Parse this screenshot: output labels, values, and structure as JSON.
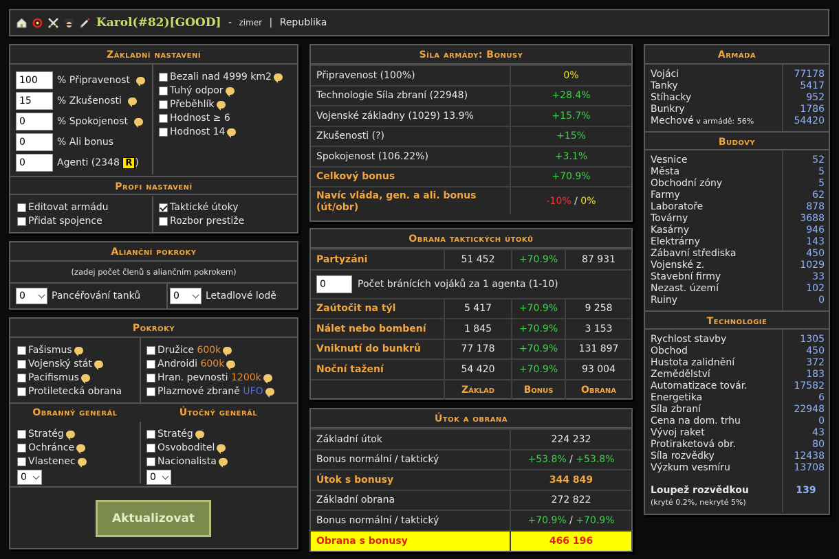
{
  "topbar": {
    "icons": [
      "home-icon",
      "alert-icon",
      "swords-icon",
      "spy-icon",
      "syringe-icon"
    ],
    "username": "Karol(#82)[GOOD]",
    "dash": " - ",
    "tag": "zimer",
    "sep": " | ",
    "government": "Republika"
  },
  "zakladni": {
    "title": "Základní nastavení",
    "fields": [
      {
        "value": "100",
        "label": "% Připravenost"
      },
      {
        "value": "15",
        "label": "% Zkušenosti"
      },
      {
        "value": "0",
        "label": "% Spokojenost"
      },
      {
        "value": "0",
        "label": "% Ali bonus"
      },
      {
        "value": "0",
        "label": "Agenti (2348 ",
        "badge": "R",
        "suffix": ")"
      }
    ],
    "checks": [
      {
        "label": "Bezali nad 4999 km2",
        "checked": false
      },
      {
        "label": "Tuhý odpor",
        "checked": false
      },
      {
        "label": "Přeběhlík",
        "checked": false
      },
      {
        "label": "Hodnost ≥ 6",
        "checked": false
      },
      {
        "label": "Hodnost 14",
        "checked": false
      }
    ]
  },
  "profi": {
    "title": "Profi nastavení",
    "left": [
      {
        "label": "Editovat armádu"
      },
      {
        "label": "Přidat spojence"
      }
    ],
    "right": [
      {
        "label": "Taktické útoky",
        "checked": true
      },
      {
        "label": "Rozbor prestiže",
        "checked": false
      }
    ]
  },
  "alianc": {
    "title": "Alianční pokroky",
    "note": "(zadej počet členů s aliančním pokrokem)",
    "sel1": {
      "value": "0",
      "label": "Pancéřování tanků"
    },
    "sel2": {
      "value": "0",
      "label": "Letadlové lodě"
    }
  },
  "pokroky": {
    "title": "Pokroky",
    "left": [
      "Fašismus",
      "Vojenský stát",
      "Pacifismus",
      "Protiletecká obrana"
    ],
    "right": [
      {
        "label": "Družice",
        "extra": "600k"
      },
      {
        "label": "Androidi",
        "extra": "600k"
      },
      {
        "label": "Hran. pevnosti",
        "extra": "1200k"
      },
      {
        "label": "Plazmové zbraně",
        "extra": "UFO"
      }
    ]
  },
  "general": {
    "obranny_title": "Obranný generál",
    "utocny_title": "Útočný generál",
    "obranny": [
      "Stratég",
      "Ochránce",
      "Vlastenec"
    ],
    "utocny": [
      "Stratég",
      "Osvoboditel",
      "Nacionalista"
    ],
    "sel_obr": "0",
    "sel_uto": "0"
  },
  "button": "Aktualizovat",
  "sila": {
    "title": "Síla armády: Bonusy",
    "rows": [
      {
        "label": "Připravenost (100%)",
        "value": "0%"
      },
      {
        "label": "Technologie Síla zbraní (22948)",
        "value": "+28.4%"
      },
      {
        "label": "Vojenské základny (1029) 13.9%",
        "value": "+15.7%"
      },
      {
        "label": "Zkušenosti (?)",
        "value": "+15%"
      },
      {
        "label": "Spokojenost (106.22%)",
        "value": "+3.1%"
      },
      {
        "label": "Celkový bonus",
        "value": "+70.9%"
      }
    ],
    "extra_label": "Navíc vláda, gen. a ali. bonus (út/obr)",
    "extra_a": "-10%",
    "extra_sep": " / ",
    "extra_b": "0%"
  },
  "obrana": {
    "title": "Obrana taktických útoků",
    "partyzani": {
      "label": "Partyzáni",
      "a": "51 452",
      "b": "+70.9%",
      "c": "87 931"
    },
    "agent_input": "0",
    "agent_label": "Počet bránících vojáků za 1 agenta (1-10)",
    "rows": [
      {
        "label": "Zaútočit na týl",
        "a": "5 417",
        "b": "+70.9%",
        "c": "9 258"
      },
      {
        "label": "Nálet nebo bombení",
        "a": "1 845",
        "b": "+70.9%",
        "c": "3 153"
      },
      {
        "label": "Vniknutí do bunkrů",
        "a": "77 178",
        "b": "+70.9%",
        "c": "131 897"
      },
      {
        "label": "Noční tažení",
        "a": "54 420",
        "b": "+70.9%",
        "c": "93 004"
      }
    ],
    "foot": [
      "Základ",
      "Bonus",
      "Obrana"
    ]
  },
  "utok": {
    "title": "Útok a obrana",
    "zakladni_utok": {
      "label": "Základní útok",
      "value": "224 232"
    },
    "bonus_u": {
      "label": "Bonus normální / taktický",
      "a": "+53.8%",
      "sep": " / ",
      "b": "+53.8%"
    },
    "utok_bonusy": {
      "label": "Útok s bonusy",
      "value": "344 849"
    },
    "zakladni_obrana": {
      "label": "Základní obrana",
      "value": "272 822"
    },
    "bonus_o": {
      "label": "Bonus normální / taktický",
      "a": "+70.9%",
      "sep": " / ",
      "b": "+70.9%"
    },
    "obrana_bonusy": {
      "label": "Obrana s bonusy",
      "value": "466 196"
    }
  },
  "armada": {
    "title": "Armáda",
    "items": [
      {
        "label": "Vojáci",
        "value": "77178"
      },
      {
        "label": "Tanky",
        "value": "5417"
      },
      {
        "label": "Stíhacky",
        "value": "952"
      },
      {
        "label": "Bunkry",
        "value": "1786"
      },
      {
        "label": "Mechové",
        "extra": " v armádě: 56%",
        "value": "54420"
      }
    ]
  },
  "budovy": {
    "title": "Budovy",
    "items": [
      {
        "label": "Vesnice",
        "value": "52"
      },
      {
        "label": "Města",
        "value": "5"
      },
      {
        "label": "Obchodní zóny",
        "value": "5"
      },
      {
        "label": "Farmy",
        "value": "62"
      },
      {
        "label": "Laboratoře",
        "value": "878"
      },
      {
        "label": "Továrny",
        "value": "3688"
      },
      {
        "label": "Kasárny",
        "value": "946"
      },
      {
        "label": "Elektrárny",
        "value": "143"
      },
      {
        "label": "Zábavní střediska",
        "value": "450"
      },
      {
        "label": "Vojenské z.",
        "value": "1029"
      },
      {
        "label": "Stavební firmy",
        "value": "33"
      },
      {
        "label": "Nezast. území",
        "value": "102"
      },
      {
        "label": "Ruiny",
        "value": "0"
      }
    ]
  },
  "technologie": {
    "title": "Technologie",
    "items": [
      {
        "label": "Rychlost stavby",
        "value": "1305"
      },
      {
        "label": "Obchod",
        "value": "450"
      },
      {
        "label": "Hustota zalidnění",
        "value": "372"
      },
      {
        "label": "Zemědělství",
        "value": "183"
      },
      {
        "label": "Automatizace továr.",
        "value": "17582"
      },
      {
        "label": "Energetika",
        "value": "6"
      },
      {
        "label": "Síla zbraní",
        "value": "22948"
      },
      {
        "label": "Cena na dom. trhu",
        "value": "0"
      },
      {
        "label": "Vývoj raket",
        "value": "43"
      },
      {
        "label": "Protiraketová obr.",
        "value": "80"
      },
      {
        "label": "Síla rozvědky",
        "value": "12438"
      },
      {
        "label": "Výzkum vesmíru",
        "value": "13708"
      }
    ],
    "loupez_label": "Loupež rozvědkou",
    "loupez_value": "139",
    "loupez_note": "(kryté 0.2%, nekryté 5%)"
  },
  "colors": {
    "accent": "#f2a640",
    "user": "#c8e06a",
    "green": "#3fd24a",
    "highlight": "#ffff00"
  }
}
